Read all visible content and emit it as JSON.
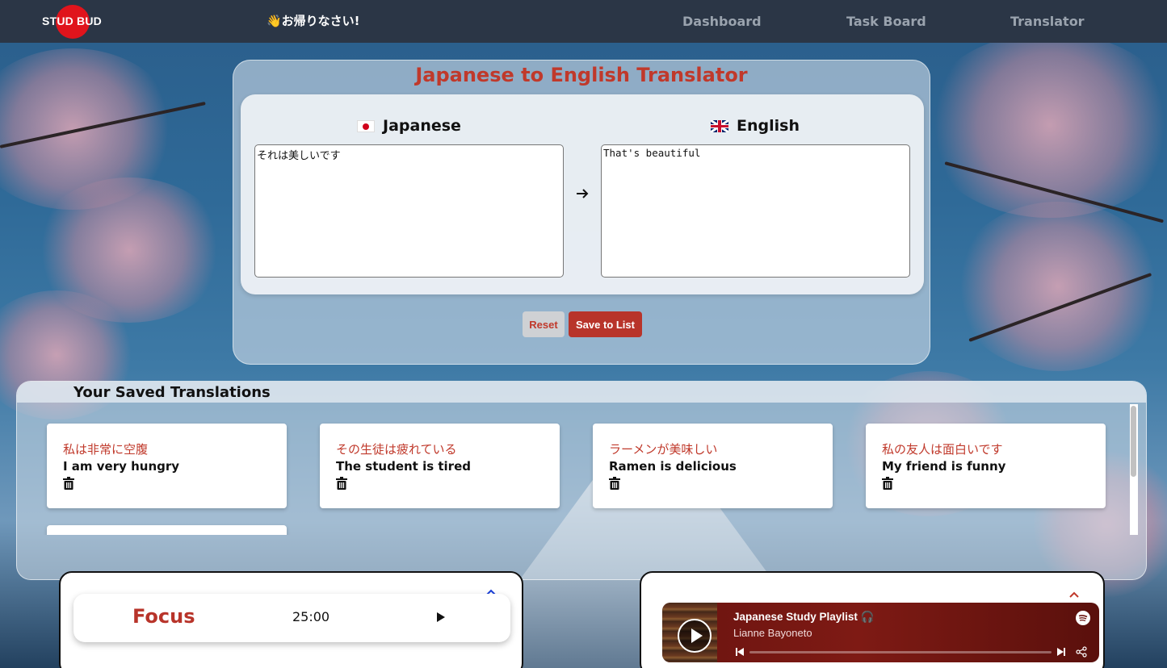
{
  "navbar": {
    "logo": "STUD BUD",
    "greeting": "👋お帰りなさい!",
    "links": [
      {
        "label": "Dashboard"
      },
      {
        "label": "Task Board"
      },
      {
        "label": "Translator"
      }
    ]
  },
  "translator": {
    "title": "Japanese to English Translator",
    "source_lang": "Japanese",
    "target_lang": "English",
    "source_text": "それは美しいです",
    "target_text": "That's beautiful",
    "reset_label": "Reset",
    "save_label": "Save to List"
  },
  "saved": {
    "title": "Your Saved Translations",
    "items": [
      {
        "japanese": "私は非常に空腹",
        "english": "I am very hungry"
      },
      {
        "japanese": "その生徒は疲れている",
        "english": "The student is tired"
      },
      {
        "japanese": "ラーメンが美味しい",
        "english": "Ramen is delicious"
      },
      {
        "japanese": "私の友人は面白いです",
        "english": "My friend is funny"
      }
    ]
  },
  "focus": {
    "label": "Focus",
    "time": "25:00"
  },
  "music": {
    "title": "Japanese Study Playlist 🎧",
    "artist": "Lianne Bayoneto"
  },
  "colors": {
    "accent": "#c0392b",
    "navbar": "#2b3646",
    "save_button": "#b8342a"
  }
}
